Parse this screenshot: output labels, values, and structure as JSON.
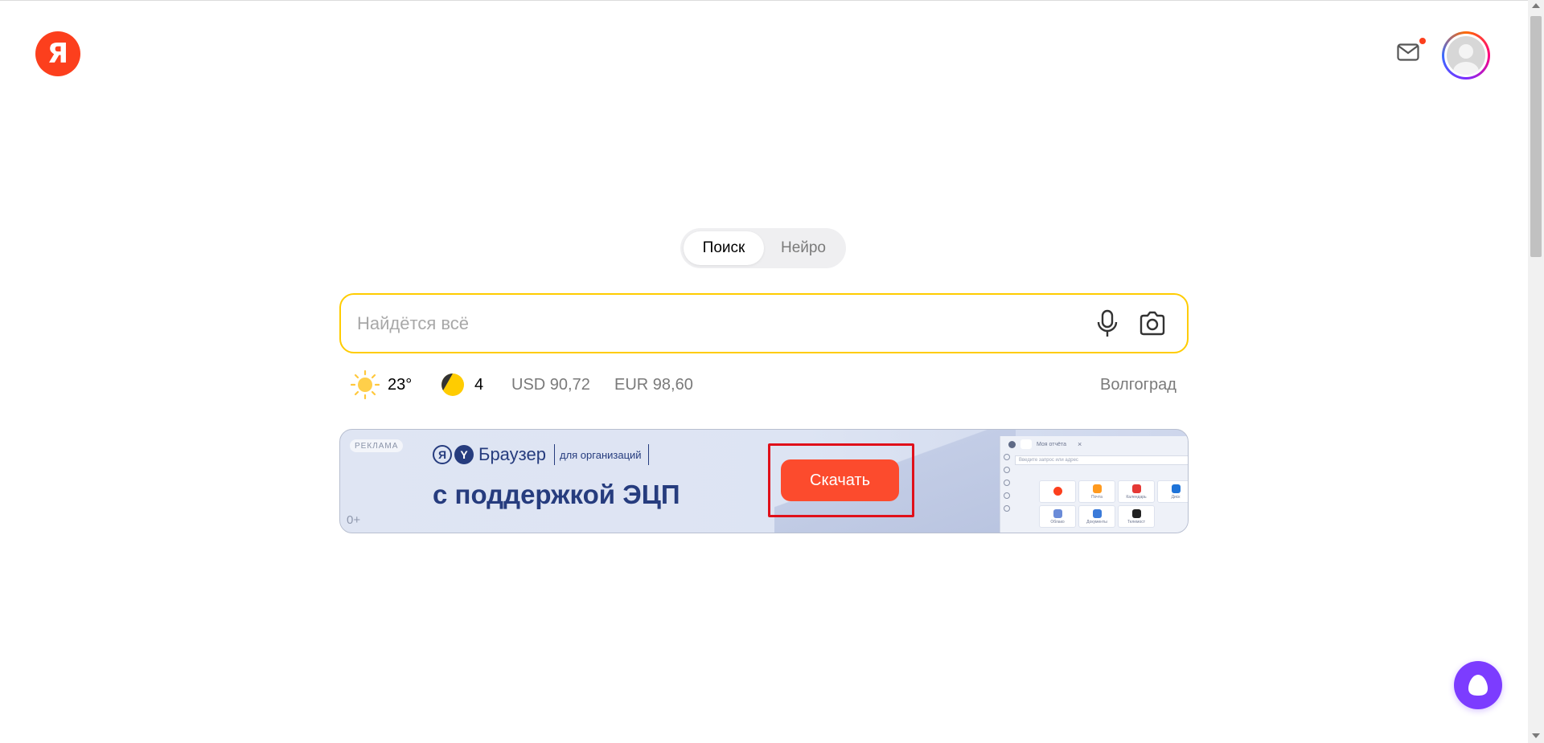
{
  "header": {
    "logo_letter": "Я",
    "mail_icon": "mail-icon",
    "avatar_icon": "user-avatar-icon"
  },
  "switcher": {
    "tabs": [
      {
        "label": "Поиск",
        "active": true
      },
      {
        "label": "Нейро",
        "active": false
      }
    ]
  },
  "search": {
    "placeholder": "Найдётся всё",
    "value": "",
    "mic_icon": "microphone-icon",
    "camera_icon": "camera-search-icon"
  },
  "informers": {
    "weather": {
      "icon": "sun-icon",
      "temp": "23°"
    },
    "traffic": {
      "icon": "traffic-icon",
      "level": "4"
    },
    "usd": "USD 90,72",
    "eur": "EUR 98,60",
    "city": "Волгоград"
  },
  "banner": {
    "ad_label": "РЕКЛАМА",
    "age": "0+",
    "brand_ya": "Я",
    "brand_y": "Y",
    "brand_name": "Браузер",
    "brand_org": "для организаций",
    "headline": "с поддержкой ЭЦП",
    "button_label": "Скачать",
    "button_color": "#fc4b2d",
    "mock": {
      "tab_title": "Моя отчёта",
      "address_placeholder": "Введите запрос или адрес",
      "tiles": [
        {
          "label": "",
          "color": "#fc3f1d"
        },
        {
          "label": "Почта",
          "color": "#ff9a1f"
        },
        {
          "label": "Календарь",
          "color": "#e53935"
        },
        {
          "label": "Диск",
          "color": "#1e73d8"
        },
        {
          "label": "Облако",
          "color": "#6a8bd8"
        },
        {
          "label": "Документы",
          "color": "#3a7ad9"
        },
        {
          "label": "Телемост",
          "color": "#222222"
        }
      ]
    }
  },
  "alice": {
    "icon": "alice-assistant-icon"
  },
  "colors": {
    "brand_red": "#fc3f1d",
    "search_border": "#ffcc00",
    "alice_purple": "#7c3cff",
    "highlight_red": "#e0101a"
  }
}
